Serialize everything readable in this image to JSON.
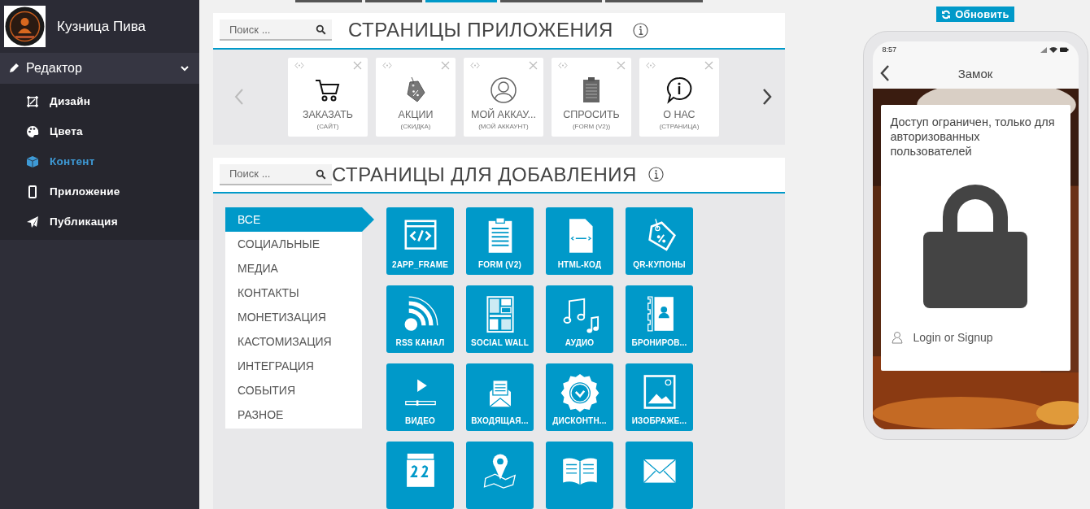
{
  "sidebar": {
    "brand": "Кузница Пива",
    "section": {
      "label": "Редактор",
      "expanded": true
    },
    "items": [
      {
        "label": "Дизайн",
        "selected": false
      },
      {
        "label": "Цвета",
        "selected": false
      },
      {
        "label": "Контент",
        "selected": true
      },
      {
        "label": "Приложение",
        "selected": false
      },
      {
        "label": "Публикация",
        "selected": false
      }
    ]
  },
  "top_tabs": [
    {
      "selected": false
    },
    {
      "selected": false
    },
    {
      "selected": true
    },
    {
      "selected": false
    },
    {
      "selected": false
    }
  ],
  "app_pages": {
    "search": {
      "placeholder": "Поиск ..."
    },
    "title": "СТРАНИЦЫ ПРИЛОЖЕНИЯ",
    "cards": [
      {
        "title": "ЗАКАЗАТЬ",
        "subtitle": "(САЙТ)"
      },
      {
        "title": "АКЦИИ",
        "subtitle": "(СКИДКА)"
      },
      {
        "title": "МОЙ АККАУ...",
        "subtitle": "(МОЙ АККАУНТ)"
      },
      {
        "title": "СПРОСИТЬ",
        "subtitle": "(FORM (V2))"
      },
      {
        "title": "О НАС",
        "subtitle": "(СТРАНИЦА)"
      }
    ]
  },
  "add_pages": {
    "search": {
      "placeholder": "Поиск ..."
    },
    "title": "СТРАНИЦЫ ДЛЯ ДОБАВЛЕНИЯ",
    "categories": [
      {
        "label": "ВСЕ",
        "selected": true
      },
      {
        "label": "СОЦИАЛЬНЫЕ",
        "selected": false
      },
      {
        "label": "МЕДИА",
        "selected": false
      },
      {
        "label": "КОНТАКТЫ",
        "selected": false
      },
      {
        "label": "МОНЕТИЗАЦИЯ",
        "selected": false
      },
      {
        "label": "КАСТОМИЗАЦИЯ",
        "selected": false
      },
      {
        "label": "ИНТЕГРАЦИЯ",
        "selected": false
      },
      {
        "label": "СОБЫТИЯ",
        "selected": false
      },
      {
        "label": "РАЗНОЕ",
        "selected": false
      }
    ],
    "tiles": [
      {
        "kind": "labelled",
        "label": "2APP_FRAME"
      },
      {
        "kind": "labelled",
        "label": "FORM (V2)"
      },
      {
        "kind": "labelled",
        "label": "HTML-КОД"
      },
      {
        "kind": "labelled",
        "label": "QR-КУПОНЫ"
      },
      {
        "kind": "labelled",
        "label": "RSS КАНАЛ"
      },
      {
        "kind": "labelled",
        "label": "SOCIAL WALL"
      },
      {
        "kind": "labelled",
        "label": "АУДИО"
      },
      {
        "kind": "labelled",
        "label": "БРОНИРОВ..."
      },
      {
        "kind": "labelled",
        "label": "ВИДЕО"
      },
      {
        "kind": "labelled",
        "label": "ВХОДЯЩАЯ..."
      },
      {
        "kind": "labelled",
        "label": "ДИСКОНТН..."
      },
      {
        "kind": "labelled",
        "label": "ИЗОБРАЖЕ..."
      },
      {
        "kind": "icon_only"
      },
      {
        "kind": "icon_only"
      },
      {
        "kind": "icon_only"
      },
      {
        "kind": "icon_only"
      }
    ]
  },
  "preview": {
    "refresh_button": "Обновить",
    "phone": {
      "time": "8:57",
      "title": "Замок",
      "message": "Доступ ограничен, только для авторизованных пользователей",
      "login": "Login or Signup"
    }
  }
}
